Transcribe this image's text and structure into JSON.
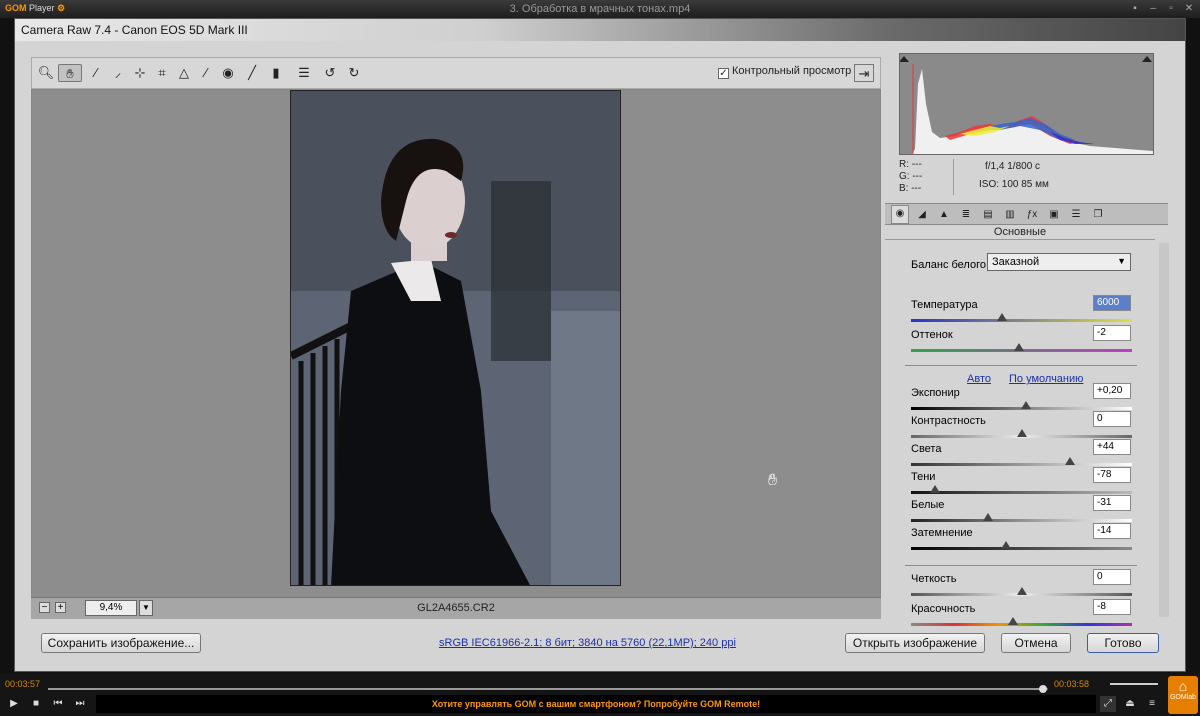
{
  "player": {
    "logo_brand": "GOM",
    "logo_suffix": "Player",
    "title": "3. Обработка в мрачных тонах.mp4",
    "time_current": "00:03:57",
    "time_total": "00:03:58",
    "progress_pct": 99.5,
    "promo": "Хотите управлять GOM с вашим смартфоном? Попробуйте GOM Remote!",
    "gomlab_label": "GOMlab"
  },
  "dialog": {
    "title": "Camera Raw 7.4  -  Canon EOS 5D Mark III",
    "preview_label": "Контрольный просмотр",
    "preview_checked": "✓",
    "zoom": "9,4%",
    "filename": "GL2A4655.CR2",
    "workflow": "sRGB IEC61966-2.1; 8 бит; 3840 на 5760 (22,1MP); 240 ppi",
    "buttons": {
      "save": "Сохранить изображение...",
      "open": "Открыть изображение",
      "cancel": "Отмена",
      "done": "Готово"
    }
  },
  "info": {
    "r": "R:   ---",
    "g": "G:   ---",
    "b": "B:   ---",
    "aperture_shutter": "f/1,4    1/800 с",
    "iso_focal": "ISO: 100    85 мм"
  },
  "panel": {
    "section": "Основные",
    "wb_label": "Баланс белого:",
    "wb_value": "Заказной",
    "auto": "Авто",
    "default": "По умолчанию",
    "sliders": [
      {
        "label": "Температура",
        "value": "6000",
        "pos": 0.41
      },
      {
        "label": "Оттенок",
        "value": "-2",
        "pos": 0.49
      },
      {
        "label": "Экспонир",
        "value": "+0,20",
        "pos": 0.52
      },
      {
        "label": "Контрастность",
        "value": "0",
        "pos": 0.5
      },
      {
        "label": "Света",
        "value": "+44",
        "pos": 0.72
      },
      {
        "label": "Тени",
        "value": "-78",
        "pos": 0.11
      },
      {
        "label": "Белые",
        "value": "-31",
        "pos": 0.35
      },
      {
        "label": "Затемнение",
        "value": "-14",
        "pos": 0.43
      },
      {
        "label": "Четкость",
        "value": "0",
        "pos": 0.5
      },
      {
        "label": "Красочность",
        "value": "-8",
        "pos": 0.46
      }
    ]
  }
}
